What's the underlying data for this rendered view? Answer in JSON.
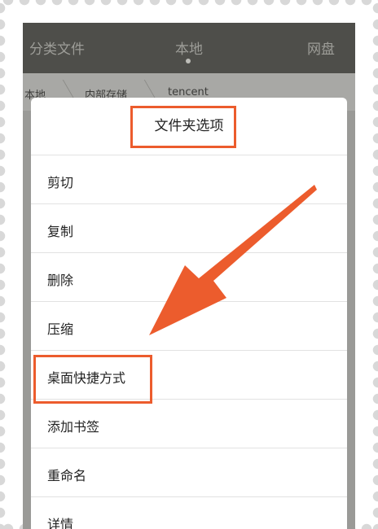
{
  "tabs": {
    "left": "分类文件",
    "middle": "本地",
    "right": "网盘"
  },
  "breadcrumb": [
    "本地",
    "内部存储",
    "tencent"
  ],
  "dialog": {
    "title": "文件夹选项",
    "items": [
      "剪切",
      "复制",
      "删除",
      "压缩",
      "桌面快捷方式",
      "添加书签",
      "重命名",
      "详情"
    ]
  },
  "colors": {
    "highlight": "#ec5c2d",
    "tabbar": "#4e4e4a"
  }
}
